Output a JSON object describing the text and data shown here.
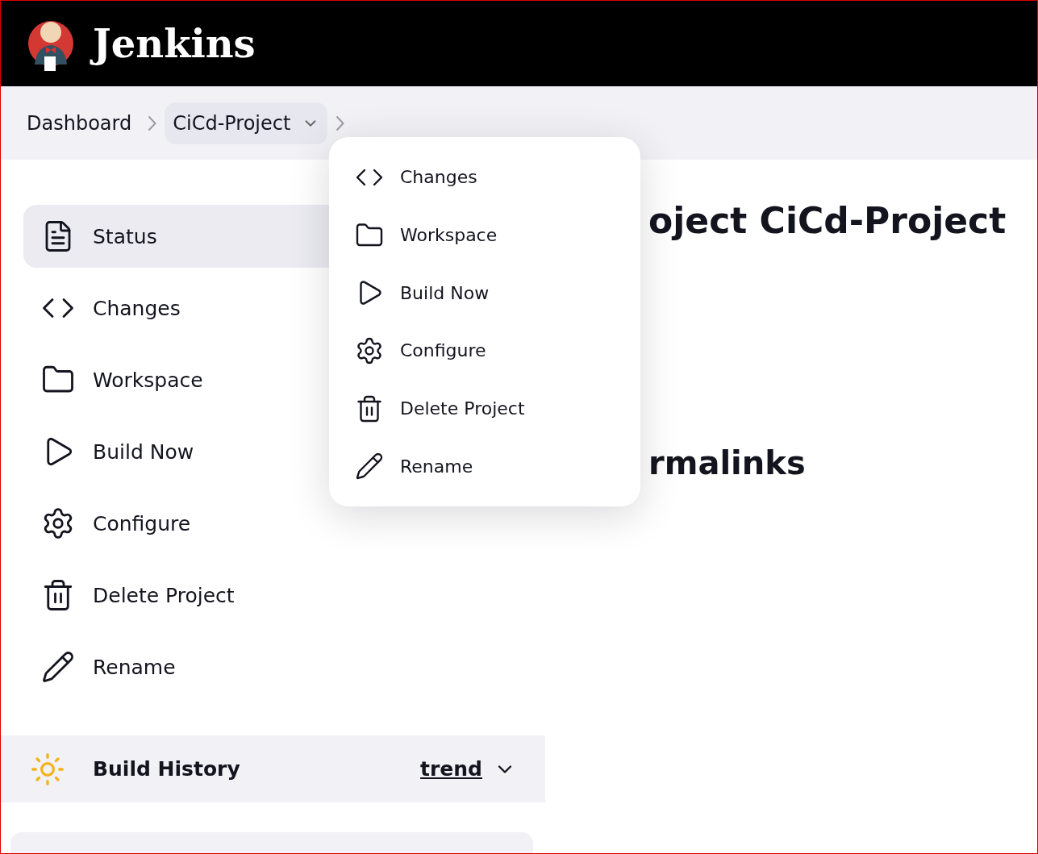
{
  "header": {
    "title": "Jenkins"
  },
  "breadcrumbs": [
    {
      "label": "Dashboard",
      "kind": "link"
    },
    {
      "label": "CiCd-Project",
      "kind": "dropdown"
    }
  ],
  "sidebar": {
    "items": [
      {
        "label": "Status",
        "kind": "doc",
        "selected": true
      },
      {
        "label": "Changes",
        "kind": "code",
        "selected": false
      },
      {
        "label": "Workspace",
        "kind": "folder",
        "selected": false
      },
      {
        "label": "Build Now",
        "kind": "play",
        "selected": false
      },
      {
        "label": "Configure",
        "kind": "gear",
        "selected": false
      },
      {
        "label": "Delete Project",
        "kind": "trash",
        "selected": false
      },
      {
        "label": "Rename",
        "kind": "pencil",
        "selected": false
      }
    ]
  },
  "build_history": {
    "title": "Build History",
    "link": "trend"
  },
  "main": {
    "title": "oject CiCd-Project",
    "section": "rmalinks"
  },
  "dropdown_menu": {
    "items": [
      {
        "label": "Changes",
        "kind": "code"
      },
      {
        "label": "Workspace",
        "kind": "folder"
      },
      {
        "label": "Build Now",
        "kind": "play"
      },
      {
        "label": "Configure",
        "kind": "gear"
      },
      {
        "label": "Delete Project",
        "kind": "trash"
      },
      {
        "label": "Rename",
        "kind": "pencil"
      }
    ]
  }
}
